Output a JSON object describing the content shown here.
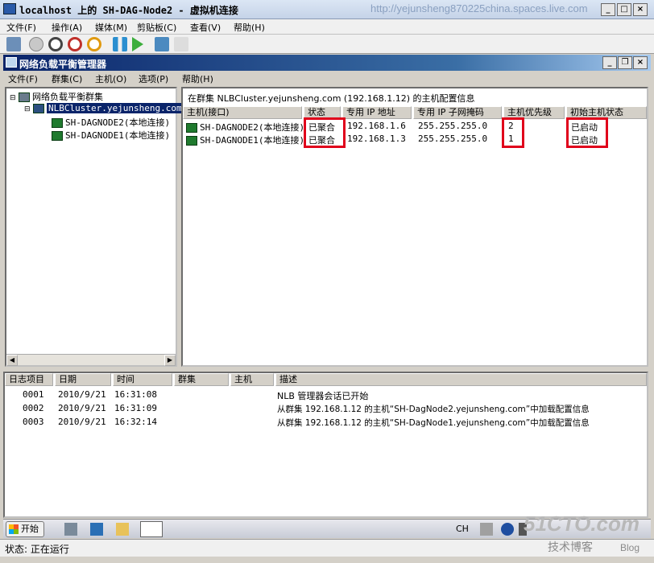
{
  "vm_window": {
    "title": "localhost 上的 SH-DAG-Node2 - 虚拟机连接",
    "watermark": "http://yejunsheng870225china.spaces.live.com",
    "menu": [
      "文件(F)",
      "操作(A)",
      "媒体(M)",
      "剪贴板(C)",
      "查看(V)",
      "帮助(H)"
    ],
    "toolbar_icons": [
      "ctrl-alt-del-icon",
      "start-icon",
      "turn-off-icon",
      "shutdown-icon",
      "power-icon",
      "pause-icon",
      "resume-icon",
      "snapshot-icon",
      "revert-icon"
    ]
  },
  "nlb_window": {
    "title": "网络负载平衡管理器",
    "menu": [
      "文件(F)",
      "群集(C)",
      "主机(O)",
      "选项(P)",
      "帮助(H)"
    ]
  },
  "tree": {
    "root": "网络负载平衡群集",
    "cluster": "NLBCluster.yejunsheng.com",
    "hosts": [
      "SH-DAGNODE2(本地连接)",
      "SH-DAGNODE1(本地连接)"
    ]
  },
  "host_info": {
    "header": "在群集 NLBCluster.yejunsheng.com (192.168.1.12) 的主机配置信息",
    "columns": [
      "主机(接口)",
      "状态",
      "专用 IP 地址",
      "专用 IP 子网掩码",
      "主机优先级",
      "初始主机状态"
    ],
    "rows": [
      {
        "host": "SH-DAGNODE2(本地连接)",
        "status": "已聚合",
        "ip": "192.168.1.6",
        "mask": "255.255.255.0",
        "priority": "2",
        "initial": "已启动"
      },
      {
        "host": "SH-DAGNODE1(本地连接)",
        "status": "已聚合",
        "ip": "192.168.1.3",
        "mask": "255.255.255.0",
        "priority": "1",
        "initial": "已启动"
      }
    ],
    "highlight_color": "#e0001b"
  },
  "log": {
    "columns": [
      "日志项目",
      "日期",
      "时间",
      "群集",
      "主机",
      "描述"
    ],
    "rows": [
      {
        "id": "0001",
        "date": "2010/9/21",
        "time": "16:31:08",
        "cluster": "",
        "host": "",
        "desc": "NLB 管理器会话已开始"
      },
      {
        "id": "0002",
        "date": "2010/9/21",
        "time": "16:31:09",
        "cluster": "",
        "host": "",
        "desc": "从群集 192.168.1.12 的主机“SH-DagNode2.yejunsheng.com”中加载配置信息"
      },
      {
        "id": "0003",
        "date": "2010/9/21",
        "time": "16:32:14",
        "cluster": "",
        "host": "",
        "desc": "从群集 192.168.1.12 的主机“SH-DagNode1.yejunsheng.com”中加载配置信息"
      }
    ]
  },
  "taskbar": {
    "start_label": "开始",
    "lang": "CH"
  },
  "status": {
    "text": "状态: 正在运行"
  },
  "branding": {
    "logo_main": "51CTO.com",
    "logo_sub": "技术博客",
    "logo_blog": "Blog"
  }
}
